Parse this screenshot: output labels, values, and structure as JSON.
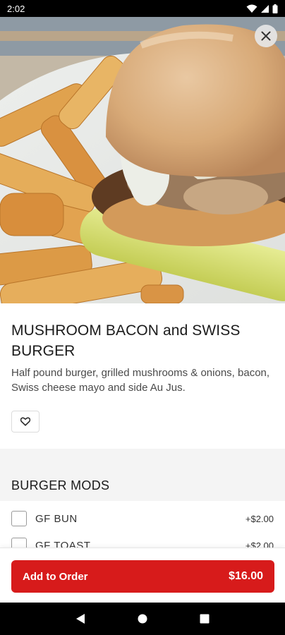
{
  "status_bar": {
    "time": "2:02",
    "icons": [
      "wifi-icon",
      "signal-icon",
      "battery-icon"
    ]
  },
  "hero": {
    "image_alt": "burger-with-fries-photo",
    "close_icon": "close-icon"
  },
  "item": {
    "title": "MUSHROOM BACON and SWISS BURGER",
    "description": "Half pound burger, grilled mushrooms & onions, bacon, Swiss cheese mayo and side Au Jus.",
    "favorite_icon": "heart-outline-icon"
  },
  "mods": {
    "header": "BURGER MODS",
    "options": [
      {
        "label": "GF BUN",
        "price": "+$2.00",
        "checked": false
      },
      {
        "label": "GF TOAST",
        "price": "+$2.00",
        "checked": false
      }
    ]
  },
  "footer": {
    "add_label": "Add to Order",
    "total": "$16.00"
  },
  "nav": {
    "icons": [
      "back-icon",
      "home-icon",
      "recents-icon"
    ]
  },
  "colors": {
    "accent": "#d71b1b",
    "background": "#ffffff",
    "section_background": "#f4f4f4"
  }
}
